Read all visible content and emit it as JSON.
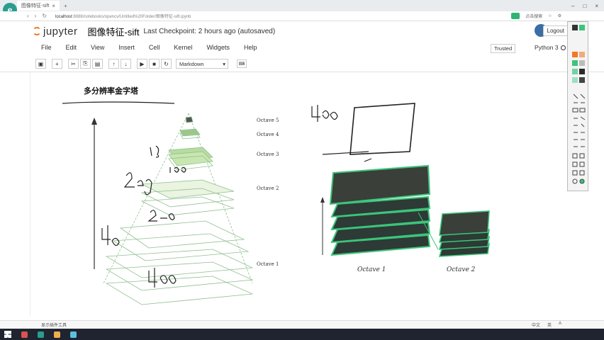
{
  "browser": {
    "tab_title": "图像特征-sift",
    "url_host": "localhost",
    "url_rest": ":8888/notebooks/opencv/Untitled%20Folder/图像特征-sift.ipynb",
    "chip_label": "",
    "right_label": "点击搜索"
  },
  "jupyter": {
    "logo_text": "jupyter",
    "notebook_title": "图像特征-sift",
    "checkpoint": "Last Checkpoint: 2 hours ago (autosaved)",
    "logout_label": "Logout",
    "trusted_label": "Trusted",
    "kernel_label": "Python 3"
  },
  "menu": [
    "File",
    "Edit",
    "View",
    "Insert",
    "Cell",
    "Kernel",
    "Widgets",
    "Help"
  ],
  "toolbar": {
    "cell_type": "Markdown",
    "kb_label": "⌨"
  },
  "content": {
    "heading": "多分辨率金字塔",
    "octave_labels": [
      "Octave 5",
      "Octave 4",
      "Octave 3",
      "Octave 2",
      "Octave 1"
    ],
    "bottom_labels": [
      "Octave 1",
      "Octave 2"
    ],
    "handwriting": [
      "1xg",
      "1,00",
      "2eg",
      "2-0",
      "4,0",
      "400",
      "400"
    ]
  },
  "status": {
    "message": "显示插件工具",
    "right_items": [
      "中文",
      "英",
      "A"
    ]
  },
  "taskbar": {
    "clock": ""
  },
  "colors": {
    "accent_green": "#3cc47a",
    "jupyter_orange": "#f37726",
    "ink": "#222222"
  }
}
